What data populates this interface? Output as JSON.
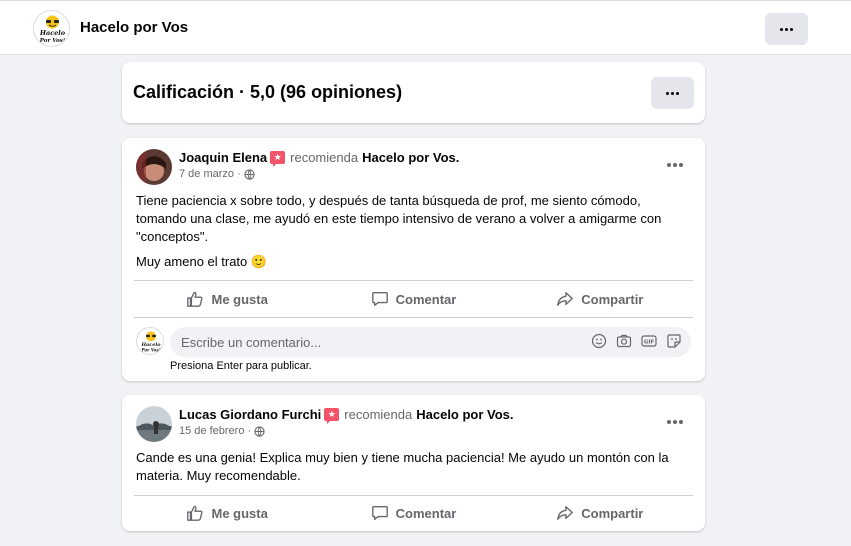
{
  "topbar": {
    "page_name": "Hacelo por Vos",
    "logo_text_line1": "Hacelo",
    "logo_text_line2": "Por Vos!"
  },
  "rating": {
    "title": "Calificación · 5,0 (96 opiniones)"
  },
  "reviews": [
    {
      "author": "Joaquin Elena",
      "recommends": "recomienda",
      "target": "Hacelo por Vos.",
      "date": "7 de marzo ·",
      "paragraphs": [
        "Tiene paciencia x sobre todo, y después de tanta búsqueda de prof, me siento cómodo, tomando una clase, me ayudó en este tiempo intensivo de verano a volver a amigarme con \"conceptos\".",
        "Muy ameno el trato 🙂"
      ]
    },
    {
      "author": "Lucas Giordano Furchi",
      "recommends": "recomienda",
      "target": "Hacelo por Vos.",
      "date": "15 de febrero ·",
      "paragraphs": [
        "Cande es una genia! Explica muy bien y tiene mucha paciencia! Me ayudo un montón con la materia. Muy recomendable."
      ]
    }
  ],
  "actions": {
    "like": "Me gusta",
    "comment": "Comentar",
    "share": "Compartir"
  },
  "comment": {
    "placeholder": "Escribe un comentario...",
    "hint": "Presiona Enter para publicar."
  },
  "icons": [
    "more-icon",
    "globe-icon",
    "like-icon",
    "comment-icon",
    "share-icon",
    "emoji-icon",
    "camera-icon",
    "gif-icon",
    "sticker-icon",
    "recommend-badge-icon"
  ],
  "colors": {
    "badge": "#f35369",
    "muted": "#65676b",
    "background": "#f0f2f5"
  }
}
